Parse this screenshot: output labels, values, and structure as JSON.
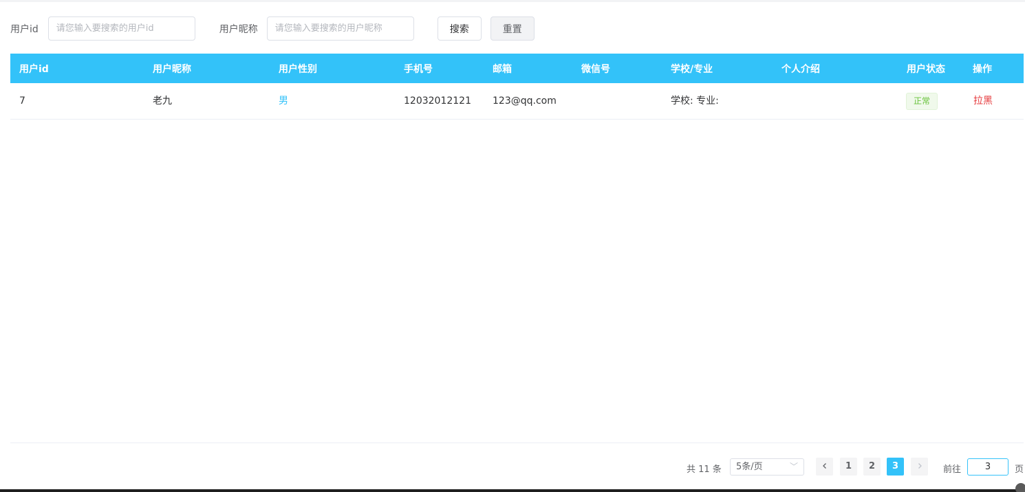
{
  "search": {
    "user_id_label": "用户id",
    "user_id_placeholder": "请您输入要搜索的用户id",
    "user_id_value": "",
    "nickname_label": "用户昵称",
    "nickname_placeholder": "请您输入要搜索的用户昵称",
    "nickname_value": "",
    "search_button": "搜索",
    "reset_button": "重置"
  },
  "table": {
    "columns": [
      "用户id",
      "用户昵称",
      "用户性别",
      "手机号",
      "邮箱",
      "微信号",
      "学校/专业",
      "个人介绍",
      "用户状态",
      "操作"
    ],
    "rows": [
      {
        "id": "7",
        "nickname": "老九",
        "gender": "男",
        "phone": "12032012121",
        "email": "123@qq.com",
        "wechat": "",
        "school_major": "学校: 专业:",
        "intro": "",
        "status": "正常",
        "action": "拉黑"
      }
    ]
  },
  "pagination": {
    "total_text": "共 11 条",
    "page_size": "5条/页",
    "pages": [
      "1",
      "2",
      "3"
    ],
    "current_page": 3,
    "goto_prefix": "前往",
    "goto_value": "3",
    "goto_suffix": "页"
  },
  "colors": {
    "accent": "#33c2f9",
    "status_normal": "#67c23a",
    "danger": "#e5383b"
  }
}
